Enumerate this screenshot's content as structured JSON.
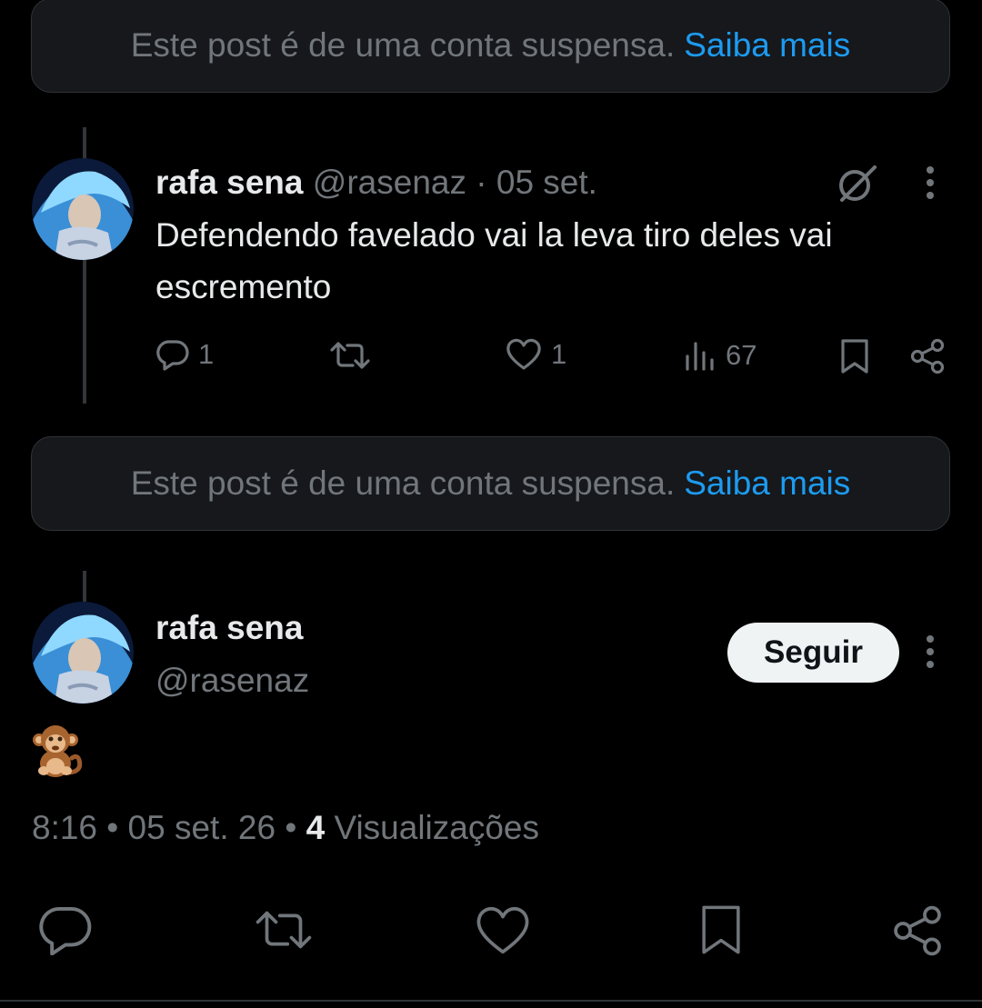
{
  "notices": [
    {
      "text": "Este post é de uma conta suspensa.",
      "link": "Saiba mais"
    },
    {
      "text": "Este post é de uma conta suspensa.",
      "link": "Saiba mais"
    }
  ],
  "reply_post": {
    "display_name": "rafa sena",
    "handle": "@rasenaz",
    "separator": "·",
    "date": "05 set.",
    "text": "Defendendo favelado vai la leva tiro deles vai escremento",
    "actions": {
      "replies": "1",
      "retweets": "",
      "likes": "1",
      "views": "67"
    }
  },
  "main_post": {
    "display_name": "rafa sena",
    "handle": "@rasenaz",
    "follow_label": "Seguir",
    "content_emoji": "🐒",
    "time": "8:16",
    "date": "05 set. 26",
    "views_count": "4",
    "views_label": "Visualizações",
    "dot": "•"
  },
  "icons": [
    "reply-icon",
    "retweet-icon",
    "like-icon",
    "views-icon",
    "bookmark-icon",
    "share-icon",
    "grok-icon",
    "more-icon",
    "monkey-emoji"
  ],
  "colors": {
    "accent": "#1d9bf0",
    "muted": "#71767b",
    "text": "#e7e9ea",
    "background": "#000000"
  }
}
